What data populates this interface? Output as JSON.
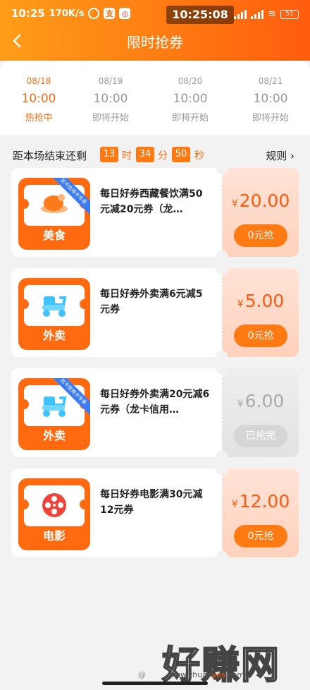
{
  "status": {
    "clock": "10:25",
    "speed": "170K/s",
    "time_overlay": "10:25:08",
    "battery": "51",
    "app1": "支"
  },
  "header": {
    "title": "限时抢券"
  },
  "sessions": [
    {
      "date": "08/18",
      "time": "10:00",
      "status": "热抢中",
      "active": true
    },
    {
      "date": "08/19",
      "time": "10:00",
      "status": "即将开始",
      "active": false
    },
    {
      "date": "08/20",
      "time": "10:00",
      "status": "即将开始",
      "active": false
    },
    {
      "date": "08/21",
      "time": "10:00",
      "status": "即将开始",
      "active": false
    }
  ],
  "countdown": {
    "label": "距本场结束还剩",
    "hours": "13",
    "hours_unit": "时",
    "minutes": "34",
    "minutes_unit": "分",
    "seconds": "50",
    "seconds_unit": "秒",
    "rules": "规则"
  },
  "coupons": [
    {
      "category": "美食",
      "desc": "每日好券西藏餐饮满50元减20元券（龙…",
      "currency": "¥",
      "price": "20.00",
      "button": "0元抢",
      "ribbon": "龙卡信用卡专享",
      "disabled": false
    },
    {
      "category": "外卖",
      "desc": "每日好券外卖满6元减5元券",
      "currency": "¥",
      "price": "5.00",
      "button": "0元抢",
      "ribbon": "",
      "disabled": false
    },
    {
      "category": "外卖",
      "desc": "每日好券外卖满20元减6元券（龙卡信用…",
      "currency": "¥",
      "price": "6.00",
      "button": "已抢完",
      "ribbon": "龙卡信用卡专享",
      "disabled": true
    },
    {
      "category": "电影",
      "desc": "每日好券电影满30元减12元券",
      "currency": "¥",
      "price": "12.00",
      "button": "0元抢",
      "ribbon": "",
      "disabled": false
    }
  ],
  "watermark": {
    "text": "好赚网",
    "url_a": "www.zhuan",
    "url_b": "yes",
    "url_c": ".com",
    "at": "@"
  },
  "colors": {
    "accent": "#ff7a12",
    "price": "#ff5a10",
    "ribbon": "#3b7cf5"
  }
}
